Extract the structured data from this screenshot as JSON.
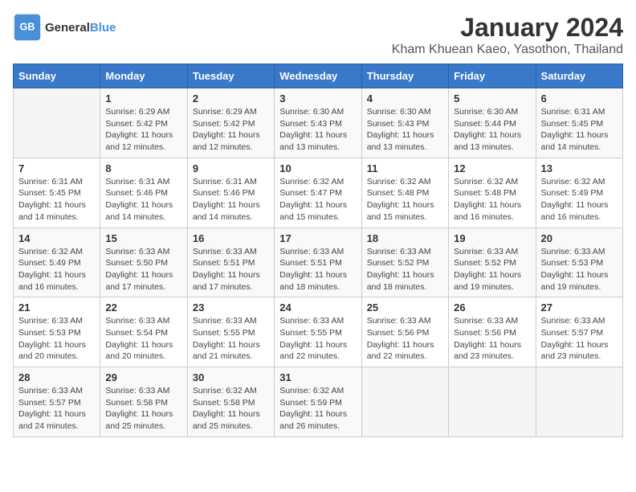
{
  "header": {
    "logo_line1": "General",
    "logo_line2": "Blue",
    "month": "January 2024",
    "location": "Kham Khuean Kaeo, Yasothon, Thailand"
  },
  "weekdays": [
    "Sunday",
    "Monday",
    "Tuesday",
    "Wednesday",
    "Thursday",
    "Friday",
    "Saturday"
  ],
  "weeks": [
    [
      {
        "day": "",
        "info": ""
      },
      {
        "day": "1",
        "info": "Sunrise: 6:29 AM\nSunset: 5:42 PM\nDaylight: 11 hours\nand 12 minutes."
      },
      {
        "day": "2",
        "info": "Sunrise: 6:29 AM\nSunset: 5:42 PM\nDaylight: 11 hours\nand 12 minutes."
      },
      {
        "day": "3",
        "info": "Sunrise: 6:30 AM\nSunset: 5:43 PM\nDaylight: 11 hours\nand 13 minutes."
      },
      {
        "day": "4",
        "info": "Sunrise: 6:30 AM\nSunset: 5:43 PM\nDaylight: 11 hours\nand 13 minutes."
      },
      {
        "day": "5",
        "info": "Sunrise: 6:30 AM\nSunset: 5:44 PM\nDaylight: 11 hours\nand 13 minutes."
      },
      {
        "day": "6",
        "info": "Sunrise: 6:31 AM\nSunset: 5:45 PM\nDaylight: 11 hours\nand 14 minutes."
      }
    ],
    [
      {
        "day": "7",
        "info": "Sunrise: 6:31 AM\nSunset: 5:45 PM\nDaylight: 11 hours\nand 14 minutes."
      },
      {
        "day": "8",
        "info": "Sunrise: 6:31 AM\nSunset: 5:46 PM\nDaylight: 11 hours\nand 14 minutes."
      },
      {
        "day": "9",
        "info": "Sunrise: 6:31 AM\nSunset: 5:46 PM\nDaylight: 11 hours\nand 14 minutes."
      },
      {
        "day": "10",
        "info": "Sunrise: 6:32 AM\nSunset: 5:47 PM\nDaylight: 11 hours\nand 15 minutes."
      },
      {
        "day": "11",
        "info": "Sunrise: 6:32 AM\nSunset: 5:48 PM\nDaylight: 11 hours\nand 15 minutes."
      },
      {
        "day": "12",
        "info": "Sunrise: 6:32 AM\nSunset: 5:48 PM\nDaylight: 11 hours\nand 16 minutes."
      },
      {
        "day": "13",
        "info": "Sunrise: 6:32 AM\nSunset: 5:49 PM\nDaylight: 11 hours\nand 16 minutes."
      }
    ],
    [
      {
        "day": "14",
        "info": "Sunrise: 6:32 AM\nSunset: 5:49 PM\nDaylight: 11 hours\nand 16 minutes."
      },
      {
        "day": "15",
        "info": "Sunrise: 6:33 AM\nSunset: 5:50 PM\nDaylight: 11 hours\nand 17 minutes."
      },
      {
        "day": "16",
        "info": "Sunrise: 6:33 AM\nSunset: 5:51 PM\nDaylight: 11 hours\nand 17 minutes."
      },
      {
        "day": "17",
        "info": "Sunrise: 6:33 AM\nSunset: 5:51 PM\nDaylight: 11 hours\nand 18 minutes."
      },
      {
        "day": "18",
        "info": "Sunrise: 6:33 AM\nSunset: 5:52 PM\nDaylight: 11 hours\nand 18 minutes."
      },
      {
        "day": "19",
        "info": "Sunrise: 6:33 AM\nSunset: 5:52 PM\nDaylight: 11 hours\nand 19 minutes."
      },
      {
        "day": "20",
        "info": "Sunrise: 6:33 AM\nSunset: 5:53 PM\nDaylight: 11 hours\nand 19 minutes."
      }
    ],
    [
      {
        "day": "21",
        "info": "Sunrise: 6:33 AM\nSunset: 5:53 PM\nDaylight: 11 hours\nand 20 minutes."
      },
      {
        "day": "22",
        "info": "Sunrise: 6:33 AM\nSunset: 5:54 PM\nDaylight: 11 hours\nand 20 minutes."
      },
      {
        "day": "23",
        "info": "Sunrise: 6:33 AM\nSunset: 5:55 PM\nDaylight: 11 hours\nand 21 minutes."
      },
      {
        "day": "24",
        "info": "Sunrise: 6:33 AM\nSunset: 5:55 PM\nDaylight: 11 hours\nand 22 minutes."
      },
      {
        "day": "25",
        "info": "Sunrise: 6:33 AM\nSunset: 5:56 PM\nDaylight: 11 hours\nand 22 minutes."
      },
      {
        "day": "26",
        "info": "Sunrise: 6:33 AM\nSunset: 5:56 PM\nDaylight: 11 hours\nand 23 minutes."
      },
      {
        "day": "27",
        "info": "Sunrise: 6:33 AM\nSunset: 5:57 PM\nDaylight: 11 hours\nand 23 minutes."
      }
    ],
    [
      {
        "day": "28",
        "info": "Sunrise: 6:33 AM\nSunset: 5:57 PM\nDaylight: 11 hours\nand 24 minutes."
      },
      {
        "day": "29",
        "info": "Sunrise: 6:33 AM\nSunset: 5:58 PM\nDaylight: 11 hours\nand 25 minutes."
      },
      {
        "day": "30",
        "info": "Sunrise: 6:32 AM\nSunset: 5:58 PM\nDaylight: 11 hours\nand 25 minutes."
      },
      {
        "day": "31",
        "info": "Sunrise: 6:32 AM\nSunset: 5:59 PM\nDaylight: 11 hours\nand 26 minutes."
      },
      {
        "day": "",
        "info": ""
      },
      {
        "day": "",
        "info": ""
      },
      {
        "day": "",
        "info": ""
      }
    ]
  ]
}
